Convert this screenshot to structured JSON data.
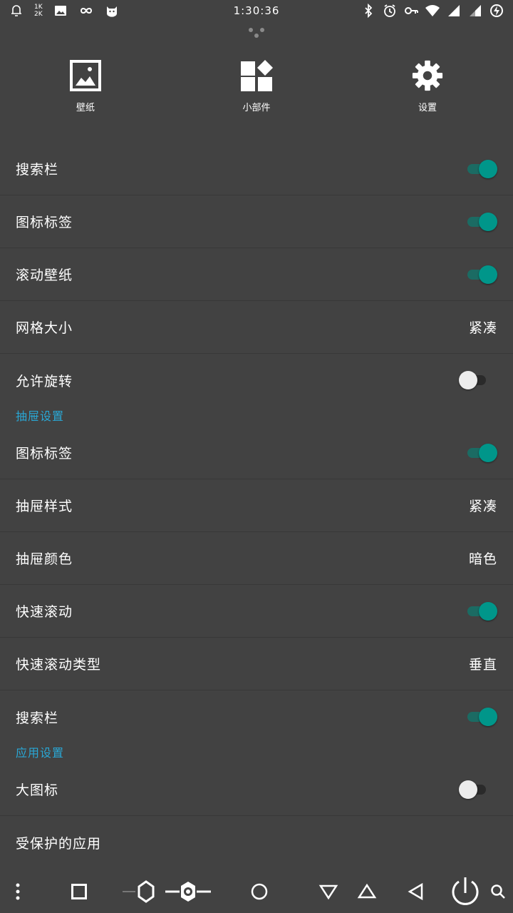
{
  "status_bar": {
    "time": "1:30:36",
    "net_up": "1K",
    "net_down": "2K",
    "left_icons": [
      "notification-bell-icon",
      "network-speed-icon",
      "image-icon",
      "infinity-icon",
      "cat-icon"
    ],
    "right_icons": [
      "bluetooth-icon",
      "alarm-icon",
      "vpn-key-icon",
      "wifi-icon",
      "signal-icon",
      "signal-icon",
      "battery-charging-icon"
    ]
  },
  "shortcuts": [
    {
      "label": "壁纸",
      "icon": "wallpaper-icon"
    },
    {
      "label": "小部件",
      "icon": "widgets-icon"
    },
    {
      "label": "设置",
      "icon": "settings-gear-icon"
    }
  ],
  "settings": {
    "search_bar": {
      "label": "搜索栏",
      "on": true
    },
    "icon_labels": {
      "label": "图标标签",
      "on": true
    },
    "scroll_wallpaper": {
      "label": "滚动壁纸",
      "on": true
    },
    "grid_size": {
      "label": "网格大小",
      "value": "紧凑"
    },
    "allow_rotation": {
      "label": "允许旋转",
      "on": false
    }
  },
  "drawer_section": {
    "title": "抽屉设置",
    "icon_labels": {
      "label": "图标标签",
      "on": true
    },
    "drawer_style": {
      "label": "抽屉样式",
      "value": "紧凑"
    },
    "drawer_color": {
      "label": "抽屉颜色",
      "value": "暗色"
    },
    "fast_scroll": {
      "label": "快速滚动",
      "on": true
    },
    "fast_scroll_type": {
      "label": "快速滚动类型",
      "value": "垂直"
    },
    "search_bar": {
      "label": "搜索栏",
      "on": true
    }
  },
  "app_section": {
    "title": "应用设置",
    "large_icons": {
      "label": "大图标",
      "on": false
    },
    "protected_apps": {
      "label": "受保护的应用"
    }
  },
  "colors": {
    "background": "#424242",
    "accent_teal": "#00968a",
    "section_blue": "#29a8d6"
  },
  "nav_bar_icons": [
    "menu-dots-icon",
    "square-icon",
    "brightness-low-icon",
    "brightness-high-icon",
    "circle-icon",
    "triangle-down-icon",
    "triangle-up-icon",
    "back-icon",
    "power-icon",
    "search-icon"
  ]
}
